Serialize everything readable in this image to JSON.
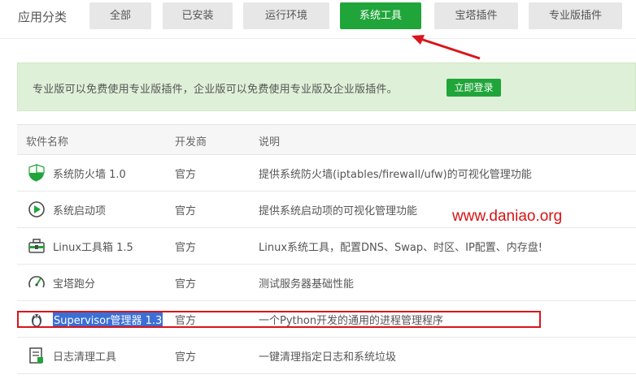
{
  "category_label": "应用分类",
  "tabs": [
    {
      "label": "全部",
      "active": false
    },
    {
      "label": "已安装",
      "active": false
    },
    {
      "label": "运行环境",
      "active": false
    },
    {
      "label": "系统工具",
      "active": true
    },
    {
      "label": "宝塔插件",
      "active": false
    },
    {
      "label": "专业版插件",
      "active": false
    }
  ],
  "notice": {
    "text": "专业版可以免费使用专业版插件，企业版可以免费使用专业版及企业版插件。",
    "login_label": "立即登录"
  },
  "table": {
    "headers": [
      "软件名称",
      "开发商",
      "说明"
    ],
    "rows": [
      {
        "icon": "shield-icon",
        "name": "系统防火墙 1.0",
        "vendor": "官方",
        "desc": "提供系统防火墙(iptables/firewall/ufw)的可视化管理功能"
      },
      {
        "icon": "play-circle-icon",
        "name": "系统启动项",
        "vendor": "官方",
        "desc": "提供系统启动项的可视化管理功能"
      },
      {
        "icon": "toolbox-icon",
        "name": "Linux工具箱 1.5",
        "vendor": "官方",
        "desc": "Linux系统工具，配置DNS、Swap、时区、IP配置、内存盘!"
      },
      {
        "icon": "gauge-icon",
        "name": "宝塔跑分",
        "vendor": "官方",
        "desc": "测试服务器基础性能"
      },
      {
        "icon": "supervisor-icon",
        "name": "Supervisor管理器 1.3",
        "vendor": "官方",
        "desc": "一个Python开发的通用的进程管理程序"
      },
      {
        "icon": "log-icon",
        "name": "日志清理工具",
        "vendor": "官方",
        "desc": "一键清理指定日志和系统垃圾"
      }
    ]
  },
  "watermark": "www.daniao.org",
  "colors": {
    "brand": "#20a53a",
    "annotation": "#d9141b"
  }
}
